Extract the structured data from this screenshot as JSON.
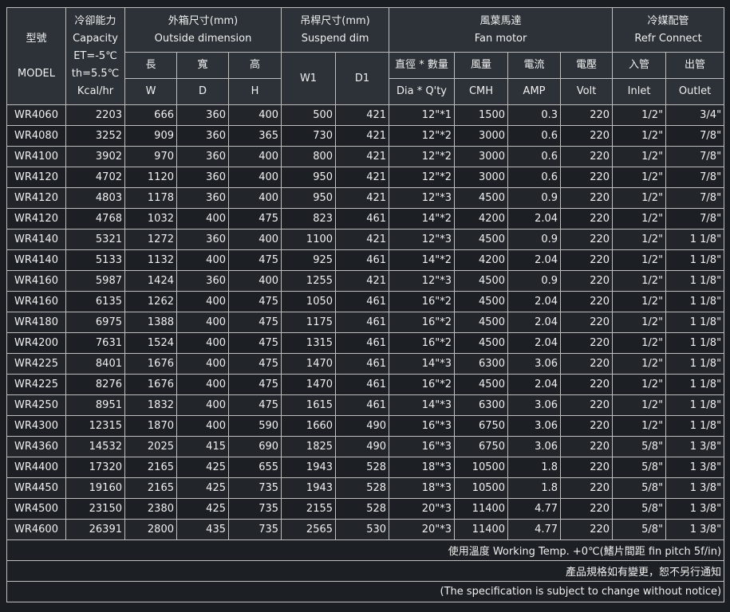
{
  "header": {
    "model": {
      "zh": "型號",
      "en": "MODEL"
    },
    "capacity": {
      "zh": "冷卻能力",
      "en": "Capacity",
      "et": "ET=-5℃",
      "th": "th=5.5℃",
      "unit": "Kcal/hr"
    },
    "outside": {
      "zh": "外箱尺寸(mm)",
      "en": "Outside dimension",
      "l": {
        "zh": "長",
        "en": "W"
      },
      "w": {
        "zh": "寬",
        "en": "D"
      },
      "h": {
        "zh": "高",
        "en": "H"
      }
    },
    "suspend": {
      "zh": "吊桿尺寸(mm)",
      "en": "Suspend dim",
      "w1": "W1",
      "d1": "D1"
    },
    "fan": {
      "zh": "風葉馬達",
      "en": "Fan motor",
      "dia": {
        "zh": "直徑 * 數量",
        "en": "Dia * Q'ty"
      },
      "flow": {
        "zh": "風量",
        "en": "CMH"
      },
      "current": {
        "zh": "電流",
        "en": "AMP"
      },
      "voltage": {
        "zh": "電壓",
        "en": "Volt"
      }
    },
    "refr": {
      "zh": "冷媒配管",
      "en": "Refr Connect",
      "inlet": {
        "zh": "入管",
        "en": "Inlet"
      },
      "outlet": {
        "zh": "出管",
        "en": "Outlet"
      }
    }
  },
  "rows": [
    [
      "WR4060",
      "2203",
      "666",
      "360",
      "400",
      "500",
      "421",
      "12\"*1",
      "1500",
      "0.3",
      "220",
      "1/2\"",
      "3/4\""
    ],
    [
      "WR4080",
      "3252",
      "909",
      "360",
      "365",
      "730",
      "421",
      "12\"*2",
      "3000",
      "0.6",
      "220",
      "1/2\"",
      "7/8\""
    ],
    [
      "WR4100",
      "3902",
      "970",
      "360",
      "400",
      "800",
      "421",
      "12\"*2",
      "3000",
      "0.6",
      "220",
      "1/2\"",
      "7/8\""
    ],
    [
      "WR4120",
      "4702",
      "1120",
      "360",
      "400",
      "950",
      "421",
      "12\"*2",
      "3000",
      "0.6",
      "220",
      "1/2\"",
      "7/8\""
    ],
    [
      "WR4120",
      "4803",
      "1178",
      "360",
      "400",
      "950",
      "421",
      "12\"*3",
      "4500",
      "0.9",
      "220",
      "1/2\"",
      "7/8\""
    ],
    [
      "WR4120",
      "4768",
      "1032",
      "400",
      "475",
      "823",
      "461",
      "14\"*2",
      "4200",
      "2.04",
      "220",
      "1/2\"",
      "7/8\""
    ],
    [
      "WR4140",
      "5321",
      "1272",
      "360",
      "400",
      "1100",
      "421",
      "12\"*3",
      "4500",
      "0.9",
      "220",
      "1/2\"",
      "1 1/8\""
    ],
    [
      "WR4140",
      "5133",
      "1132",
      "400",
      "475",
      "925",
      "461",
      "14\"*2",
      "4200",
      "2.04",
      "220",
      "1/2\"",
      "1 1/8\""
    ],
    [
      "WR4160",
      "5987",
      "1424",
      "360",
      "400",
      "1255",
      "421",
      "12\"*3",
      "4500",
      "0.9",
      "220",
      "1/2\"",
      "1 1/8\""
    ],
    [
      "WR4160",
      "6135",
      "1262",
      "400",
      "475",
      "1050",
      "461",
      "16\"*2",
      "4500",
      "2.04",
      "220",
      "1/2\"",
      "1 1/8\""
    ],
    [
      "WR4180",
      "6975",
      "1388",
      "400",
      "475",
      "1175",
      "461",
      "16\"*2",
      "4500",
      "2.04",
      "220",
      "1/2\"",
      "1 1/8\""
    ],
    [
      "WR4200",
      "7631",
      "1524",
      "400",
      "475",
      "1315",
      "461",
      "16\"*2",
      "4500",
      "2.04",
      "220",
      "1/2\"",
      "1 1/8\""
    ],
    [
      "WR4225",
      "8401",
      "1676",
      "400",
      "475",
      "1470",
      "461",
      "14\"*3",
      "6300",
      "3.06",
      "220",
      "1/2\"",
      "1 1/8\""
    ],
    [
      "WR4225",
      "8276",
      "1676",
      "400",
      "475",
      "1470",
      "461",
      "16\"*2",
      "4500",
      "2.04",
      "220",
      "1/2\"",
      "1 1/8\""
    ],
    [
      "WR4250",
      "8951",
      "1832",
      "400",
      "475",
      "1615",
      "461",
      "14\"*3",
      "6300",
      "3.06",
      "220",
      "1/2\"",
      "1 1/8\""
    ],
    [
      "WR4300",
      "12315",
      "1870",
      "400",
      "590",
      "1660",
      "490",
      "16\"*3",
      "6750",
      "3.06",
      "220",
      "1/2\"",
      "1 1/8\""
    ],
    [
      "WR4360",
      "14532",
      "2025",
      "415",
      "690",
      "1825",
      "490",
      "16\"*3",
      "6750",
      "3.06",
      "220",
      "5/8\"",
      "1 3/8\""
    ],
    [
      "WR4400",
      "17320",
      "2165",
      "425",
      "655",
      "1943",
      "528",
      "18\"*3",
      "10500",
      "1.8",
      "220",
      "5/8\"",
      "1 3/8\""
    ],
    [
      "WR4450",
      "19160",
      "2165",
      "425",
      "735",
      "1943",
      "528",
      "18\"*3",
      "10500",
      "1.8",
      "220",
      "5/8\"",
      "1 3/8\""
    ],
    [
      "WR4500",
      "23150",
      "2380",
      "425",
      "735",
      "2155",
      "528",
      "20\"*3",
      "11400",
      "4.77",
      "220",
      "5/8\"",
      "1 3/8\""
    ],
    [
      "WR4600",
      "26391",
      "2800",
      "435",
      "735",
      "2565",
      "530",
      "20\"*3",
      "11400",
      "4.77",
      "220",
      "5/8\"",
      "1 3/8\""
    ]
  ],
  "notes": [
    "使用溫度 Working Temp. +0℃(鰭片間距 fin pitch 5f/in)",
    "產品規格如有變更，恕不另行通知",
    "(The specification is subject to change without notice)"
  ]
}
